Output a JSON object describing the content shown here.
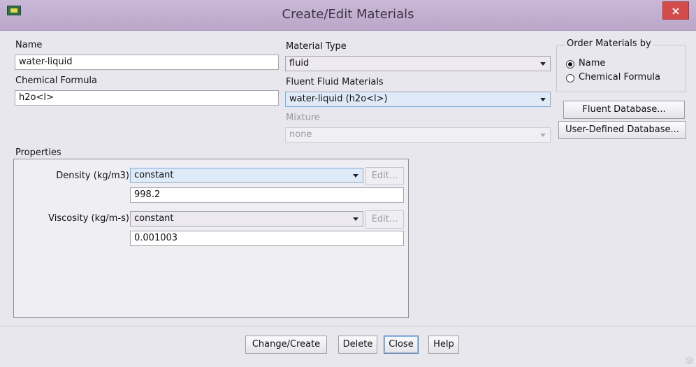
{
  "window": {
    "title": "Create/Edit Materials",
    "close_symbol": "×"
  },
  "name": {
    "label": "Name",
    "value": "water-liquid"
  },
  "chemical_formula": {
    "label": "Chemical Formula",
    "value": "h2o<l>"
  },
  "material_type": {
    "label": "Material Type",
    "value": "fluid"
  },
  "fluent_materials": {
    "label": "Fluent Fluid Materials",
    "value": "water-liquid (h2o<l>)"
  },
  "mixture": {
    "label": "Mixture",
    "value": "none"
  },
  "order_by": {
    "label": "Order Materials by",
    "options": [
      {
        "label": "Name",
        "selected": true
      },
      {
        "label": "Chemical Formula",
        "selected": false
      }
    ]
  },
  "database_buttons": {
    "fluent": "Fluent Database...",
    "user_defined": "User-Defined Database..."
  },
  "properties": {
    "label": "Properties",
    "rows": [
      {
        "label": "Density (kg/m3)",
        "method": "constant",
        "edit": "Edit...",
        "value": "998.2"
      },
      {
        "label": "Viscosity (kg/m-s)",
        "method": "constant",
        "edit": "Edit...",
        "value": "0.001003"
      }
    ]
  },
  "actions": {
    "change_create": "Change/Create",
    "delete": "Delete",
    "close": "Close",
    "help": "Help"
  }
}
